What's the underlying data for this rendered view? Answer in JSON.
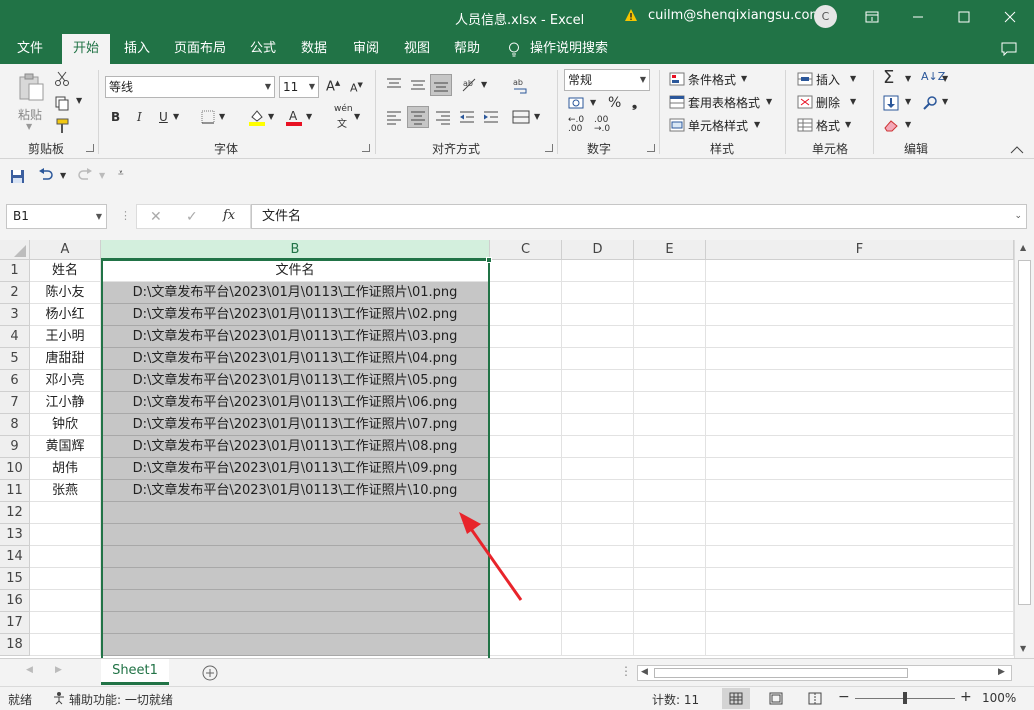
{
  "window": {
    "title": "人员信息.xlsx  -  Excel",
    "user": "cuilm@shenqixiangsu.com",
    "avatar_letter": "C",
    "icons": {
      "warning": "warning-icon",
      "restore": "ribbon-display-icon",
      "minimize": "minimize-icon",
      "maximize": "maximize-icon",
      "close": "close-icon"
    }
  },
  "tabs": [
    "文件",
    "开始",
    "插入",
    "页面布局",
    "公式",
    "数据",
    "审阅",
    "视图",
    "帮助",
    "操作说明搜索"
  ],
  "ribbon": {
    "clipboard": {
      "paste": "粘贴",
      "label": "剪贴板"
    },
    "font": {
      "name": "等线",
      "size": "11",
      "bold": "B",
      "italic": "I",
      "underline": "U",
      "label": "字体",
      "phonetic_top": "wén",
      "phonetic_bottom": "文"
    },
    "alignment": {
      "label": "对齐方式"
    },
    "number": {
      "format": "常规",
      "percent": "%",
      "label": "数字"
    },
    "styles": {
      "conditional": "条件格式",
      "table": "套用表格格式",
      "cell": "单元格样式",
      "label": "样式"
    },
    "cells": {
      "insert": "插入",
      "delete": "删除",
      "format": "格式",
      "label": "单元格"
    },
    "editing": {
      "label": "编辑"
    }
  },
  "formula_bar": {
    "name_box": "B1",
    "fx": "fx",
    "content": "文件名"
  },
  "columns": [
    "A",
    "B",
    "C",
    "D",
    "E",
    "F"
  ],
  "rows": [
    "1",
    "2",
    "3",
    "4",
    "5",
    "6",
    "7",
    "8",
    "9",
    "10",
    "11",
    "12",
    "13",
    "14",
    "15",
    "16",
    "17",
    "18"
  ],
  "cells": [
    [
      "姓名",
      "文件名"
    ],
    [
      "陈小友",
      "D:\\文章发布平台\\2023\\01月\\0113\\工作证照片\\01.png"
    ],
    [
      "杨小红",
      "D:\\文章发布平台\\2023\\01月\\0113\\工作证照片\\02.png"
    ],
    [
      "王小明",
      "D:\\文章发布平台\\2023\\01月\\0113\\工作证照片\\03.png"
    ],
    [
      "唐甜甜",
      "D:\\文章发布平台\\2023\\01月\\0113\\工作证照片\\04.png"
    ],
    [
      "邓小亮",
      "D:\\文章发布平台\\2023\\01月\\0113\\工作证照片\\05.png"
    ],
    [
      "江小静",
      "D:\\文章发布平台\\2023\\01月\\0113\\工作证照片\\06.png"
    ],
    [
      "钟欣",
      "D:\\文章发布平台\\2023\\01月\\0113\\工作证照片\\07.png"
    ],
    [
      "黄国辉",
      "D:\\文章发布平台\\2023\\01月\\0113\\工作证照片\\08.png"
    ],
    [
      "胡伟",
      "D:\\文章发布平台\\2023\\01月\\0113\\工作证照片\\09.png"
    ],
    [
      "张燕",
      "D:\\文章发布平台\\2023\\01月\\0113\\工作证照片\\10.png"
    ]
  ],
  "sheet_tab": "Sheet1",
  "status": {
    "ready": "就绪",
    "accessibility": "辅助功能: 一切就绪",
    "count": "计数: 11",
    "zoom": "100%",
    "zoom_minus": "−",
    "zoom_plus": "+"
  },
  "colors": {
    "accent": "#217346",
    "selection": "#c6c6c6",
    "arrow": "#e8242b"
  }
}
